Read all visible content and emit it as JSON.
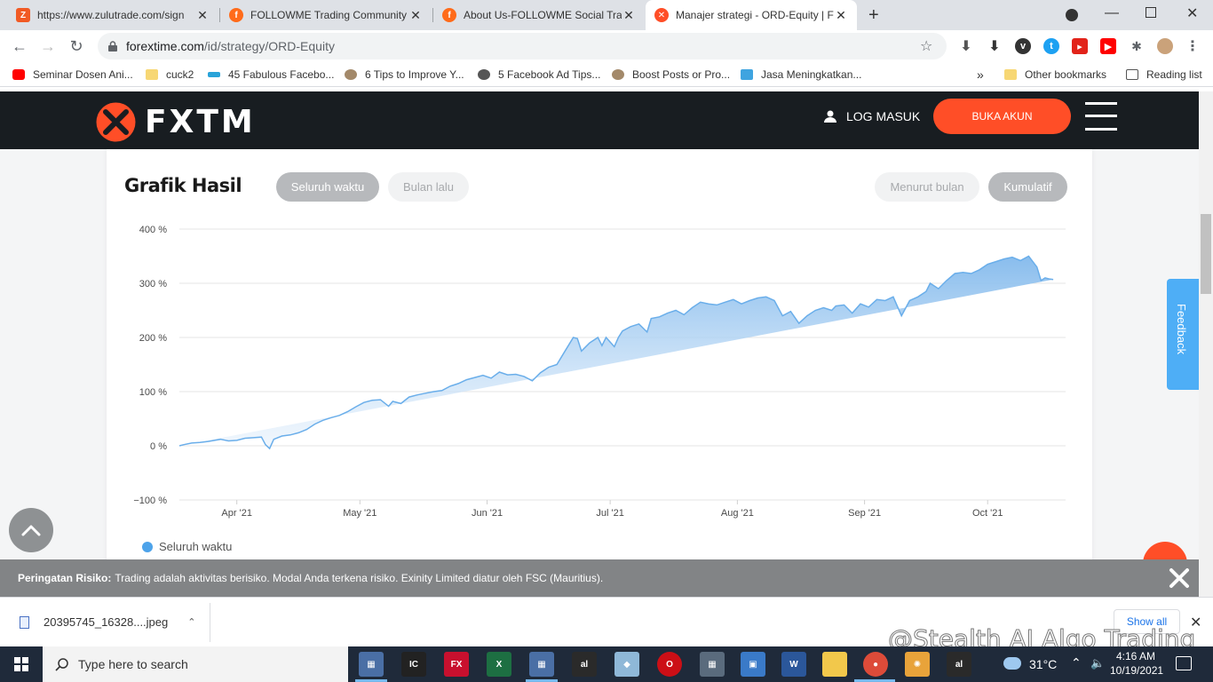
{
  "tabs": [
    {
      "title": "https://www.zulutrade.com/sign",
      "favicon": "zulutrade-icon",
      "color": "#f15a24"
    },
    {
      "title": "FOLLOWME Trading Community",
      "favicon": "followme-icon",
      "color": "#ff6b1a"
    },
    {
      "title": "About Us-FOLLOWME Social Trad",
      "favicon": "followme-icon",
      "color": "#ff6b1a"
    },
    {
      "title": "Manajer strategi - ORD-Equity | F",
      "favicon": "fxtm-icon",
      "color": "#ff4e27"
    }
  ],
  "address": {
    "host": "forextime.com",
    "path": "/id/strategy/ORD-Equity"
  },
  "bookmarks": [
    {
      "label": "Seminar Dosen Ani...",
      "color": "#ff0000"
    },
    {
      "label": "cuck2",
      "color": "#f7d774"
    },
    {
      "label": "45 Fabulous Facebo...",
      "color": "#29a3d9"
    },
    {
      "label": "6 Tips to Improve Y...",
      "color": "#a3896a"
    },
    {
      "label": "5 Facebook Ad Tips...",
      "color": "#555555"
    },
    {
      "label": "Boost Posts or Pro...",
      "color": "#a3896a"
    },
    {
      "label": "Jasa Meningkatkan...",
      "color": "#3fa4e0"
    }
  ],
  "bookmarks_more": "»",
  "other_bookmarks": "Other bookmarks",
  "reading_list": "Reading list",
  "header": {
    "brand": "FXTM",
    "login": "LOG MASUK",
    "open_account": "BUKA AKUN"
  },
  "card": {
    "title": "Grafik Hasil",
    "range_tabs": [
      {
        "label": "Seluruh waktu",
        "active": true
      },
      {
        "label": "Bulan lalu",
        "active": false
      }
    ],
    "mode_tabs": [
      {
        "label": "Menurut bulan",
        "active": false
      },
      {
        "label": "Kumulatif",
        "active": true
      }
    ],
    "legend": "Seluruh waktu"
  },
  "feedback": "Feedback",
  "risk": {
    "label": "Peringatan Risiko:",
    "text": "Trading adalah aktivitas berisiko. Modal Anda terkena risiko. Exinity Limited diatur oleh FSC (Mauritius)."
  },
  "download": {
    "file": "20395745_16328....jpeg",
    "show_all": "Show all"
  },
  "watermark": "@Stealth AI Algo Trading",
  "taskbar": {
    "search": "Type here to search",
    "temp": "31°C",
    "time": "4:16 AM",
    "date": "10/19/2021"
  },
  "chart_data": {
    "type": "area",
    "title": "Grafik Hasil",
    "series": [
      {
        "name": "Seluruh waktu",
        "color": "#4da3ea"
      }
    ],
    "y_ticks": [
      "400 %",
      "300 %",
      "200 %",
      "100 %",
      "0 %",
      "−100 %"
    ],
    "y_tick_values": [
      400,
      300,
      200,
      100,
      0,
      -100
    ],
    "ylim": [
      -100,
      400
    ],
    "x_ticks": [
      "Apr '21",
      "May '21",
      "Jun '21",
      "Jul '21",
      "Aug '21",
      "Sep '21",
      "Oct '21"
    ],
    "x_tick_days": [
      14,
      44,
      75,
      105,
      136,
      167,
      197
    ],
    "xlim_days": [
      0,
      216
    ],
    "x": [
      0,
      1,
      3,
      5,
      7,
      10,
      12,
      14,
      16,
      18,
      20,
      21,
      22,
      23,
      25,
      27,
      29,
      31,
      33,
      35,
      37,
      39,
      41,
      43,
      45,
      47,
      49,
      51,
      52,
      54,
      56,
      58,
      60,
      62,
      64,
      66,
      68,
      70,
      72,
      74,
      76,
      78,
      80,
      82,
      84,
      86,
      88,
      90,
      92,
      94,
      96,
      97,
      98,
      100,
      102,
      103,
      104,
      106,
      107,
      108,
      110,
      112,
      114,
      115,
      117,
      119,
      121,
      123,
      125,
      127,
      129,
      131,
      133,
      135,
      137,
      139,
      141,
      143,
      145,
      147,
      149,
      151,
      153,
      155,
      157,
      159,
      160,
      162,
      164,
      166,
      168,
      170,
      172,
      174,
      176,
      178,
      180,
      182,
      183,
      185,
      187,
      189,
      191,
      193,
      195,
      197,
      199,
      201,
      203,
      205,
      207,
      209,
      210,
      211,
      212,
      213,
      214,
      216
    ],
    "values": [
      0,
      2,
      5,
      6,
      8,
      12,
      9,
      10,
      14,
      15,
      16,
      2,
      -5,
      12,
      18,
      20,
      24,
      30,
      40,
      47,
      52,
      56,
      63,
      72,
      80,
      84,
      85,
      73,
      82,
      78,
      90,
      94,
      97,
      100,
      102,
      110,
      115,
      122,
      126,
      130,
      125,
      136,
      131,
      132,
      128,
      120,
      135,
      145,
      150,
      175,
      200,
      198,
      175,
      190,
      200,
      185,
      200,
      183,
      200,
      212,
      220,
      225,
      210,
      235,
      238,
      245,
      250,
      242,
      255,
      265,
      262,
      260,
      265,
      270,
      262,
      268,
      273,
      275,
      268,
      240,
      248,
      226,
      240,
      250,
      255,
      250,
      258,
      260,
      245,
      262,
      256,
      270,
      268,
      275,
      240,
      268,
      275,
      285,
      300,
      290,
      305,
      318,
      320,
      318,
      325,
      335,
      340,
      345,
      348,
      342,
      350,
      330,
      305,
      310,
      308,
      307
    ]
  }
}
